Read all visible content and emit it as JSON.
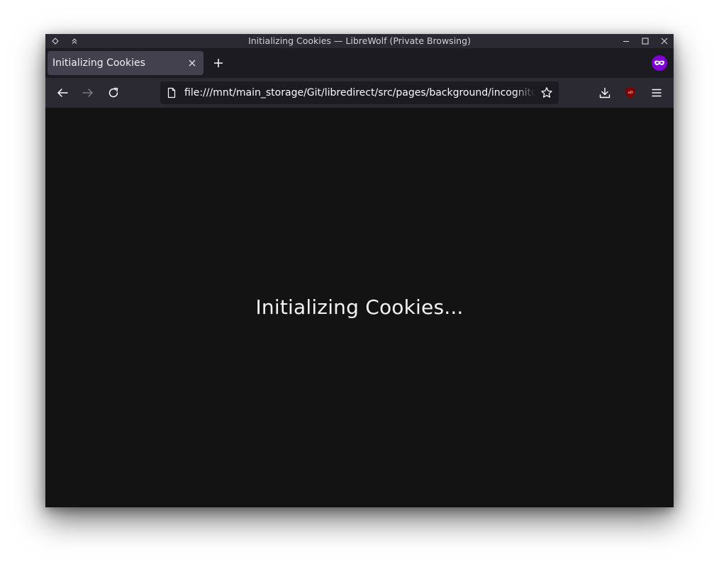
{
  "window": {
    "title": "Initializing Cookies — LibreWolf (Private Browsing)"
  },
  "titlebar_buttons": {
    "left": [
      "keep-above-icon",
      "shade-icon"
    ],
    "right": [
      "minimize-icon",
      "maximize-icon",
      "close-icon"
    ]
  },
  "tabs": [
    {
      "label": "Initializing Cookies",
      "active": true
    }
  ],
  "new_tab_icon": "plus-icon",
  "private_browsing_icon": "private-mask-icon",
  "navbar": {
    "url": "file:///mnt/main_storage/Git/libredirect/src/pages/background/incognito",
    "buttons": [
      "back-arrow-icon",
      "forward-arrow-icon",
      "reload-icon",
      "download-icon",
      "ublock-origin-icon",
      "hamburger-menu-icon"
    ]
  },
  "content": {
    "message": "Initializing Cookies..."
  },
  "colors": {
    "titlebar": "#2b2a33",
    "tabstrip": "#1c1b22",
    "active_tab": "#42414d",
    "navbar": "#2b2a33",
    "urlbar": "#1c1b22",
    "content_bg": "#131313",
    "private_accent": "#8000d7",
    "ublock_red": "#800000"
  }
}
